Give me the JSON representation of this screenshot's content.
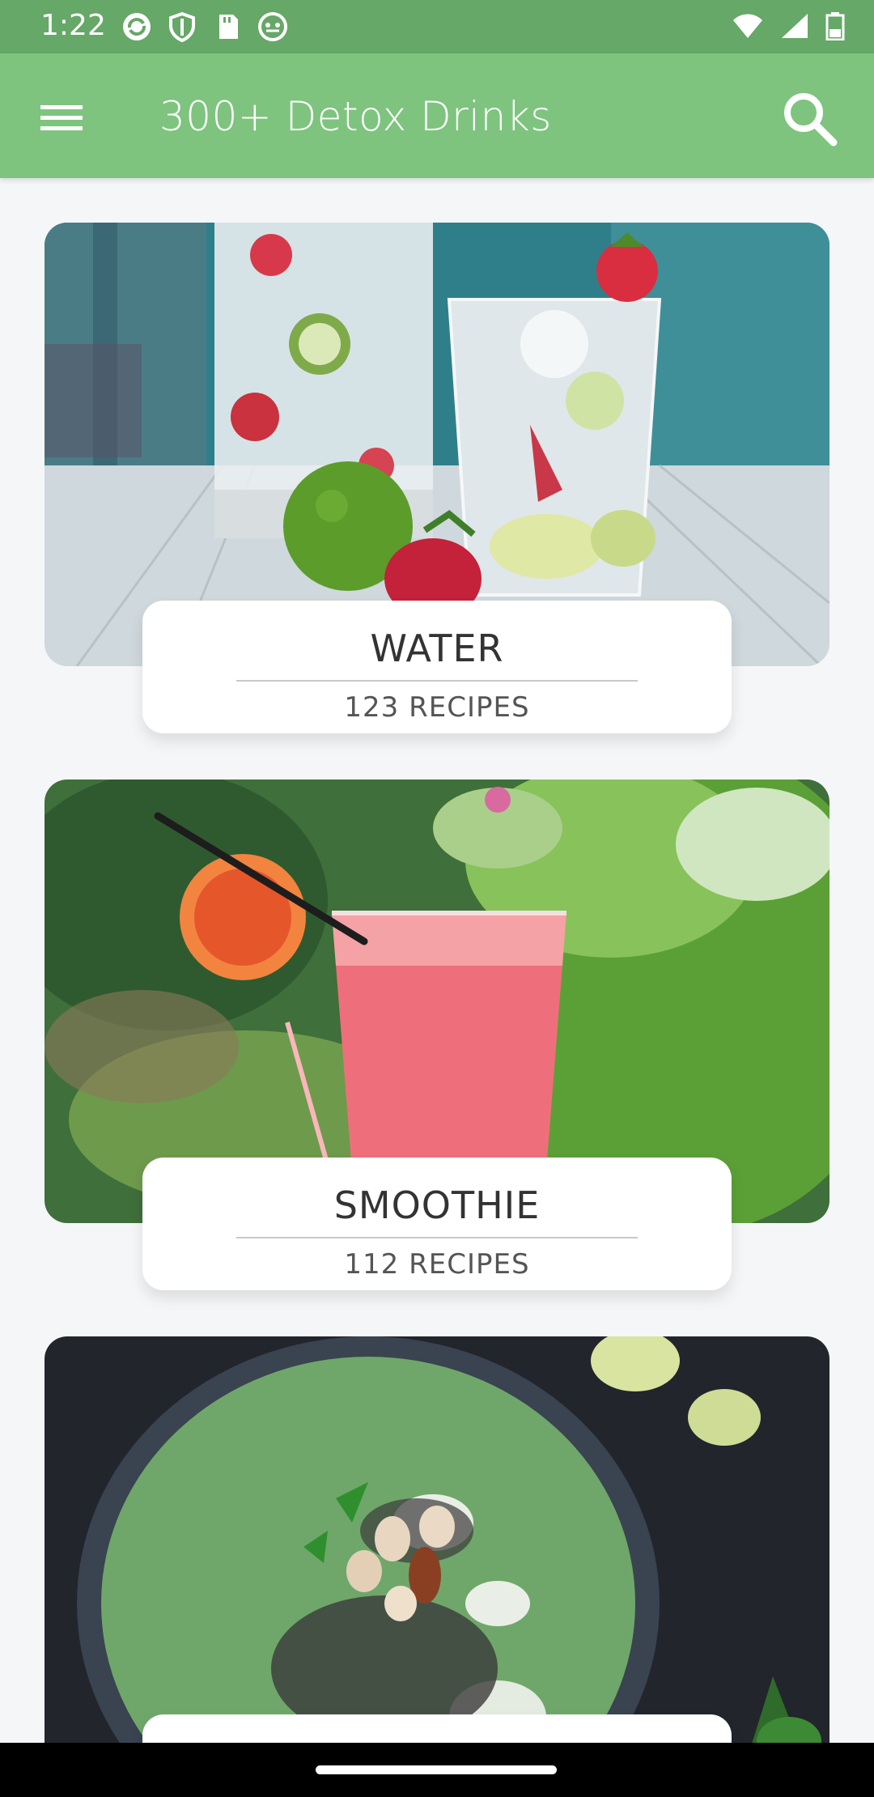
{
  "status_bar": {
    "time": "1:22"
  },
  "app_bar": {
    "title": "300+ Detox Drinks"
  },
  "categories": [
    {
      "title": "WATER",
      "count": "123 RECIPES"
    },
    {
      "title": "SMOOTHIE",
      "count": "112 RECIPES"
    },
    {
      "title": "",
      "count": ""
    }
  ],
  "colors": {
    "status_bar": "#66a867",
    "app_bar": "#7ec47f",
    "background": "#f5f6f8"
  },
  "icons": {
    "menu": "hamburger-menu-icon",
    "search": "search-icon"
  }
}
